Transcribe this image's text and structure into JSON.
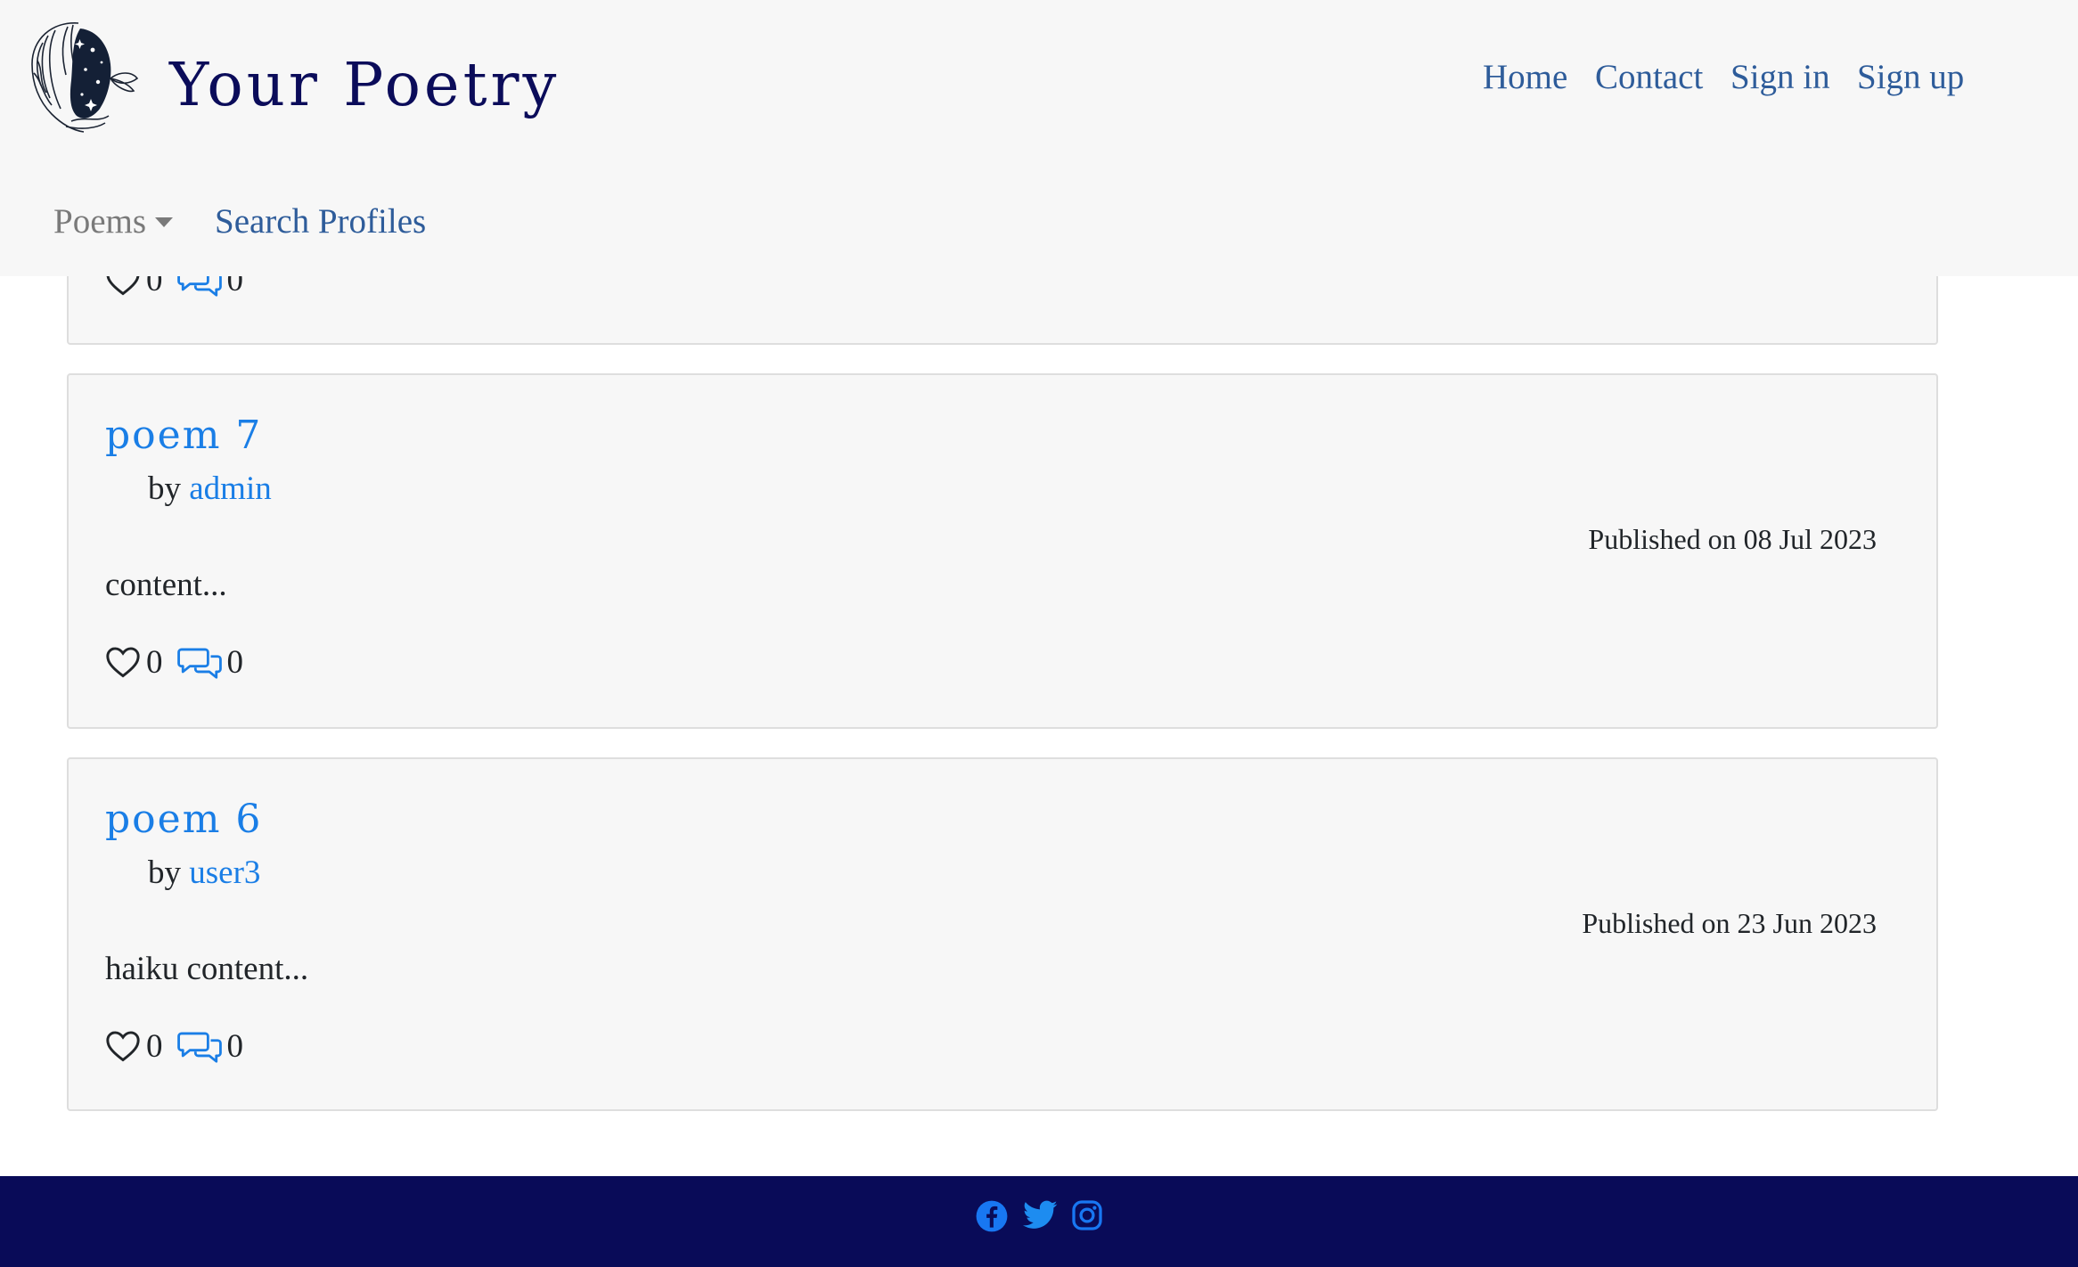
{
  "header": {
    "brand": "Your Poetry",
    "logo_icon": "woman-profile-logo",
    "nav": {
      "home": "Home",
      "contact": "Contact",
      "sign_in": "Sign in",
      "sign_up": "Sign up"
    },
    "subnav": {
      "poems": "Poems",
      "search_profiles": "Search Profiles"
    }
  },
  "poems": [
    {
      "likes": "0",
      "comments": "0"
    },
    {
      "title": "poem 7",
      "by_label": "by",
      "author": "admin",
      "published": "Published on 08 Jul 2023",
      "excerpt": "content...",
      "likes": "0",
      "comments": "0"
    },
    {
      "title": "poem 6",
      "by_label": "by",
      "author": "user3",
      "published": "Published on 23 Jun 2023",
      "excerpt": "haiku content...",
      "likes": "0",
      "comments": "0"
    }
  ],
  "footer": {
    "icons": [
      "facebook-icon",
      "twitter-icon",
      "instagram-icon"
    ]
  },
  "colors": {
    "navbar_bg": "#f7f7f7",
    "brand": "#0b0c5a",
    "nav_link": "#2e5c9a",
    "link_blue": "#1a7ee6",
    "footer_bg": "#090b58"
  }
}
